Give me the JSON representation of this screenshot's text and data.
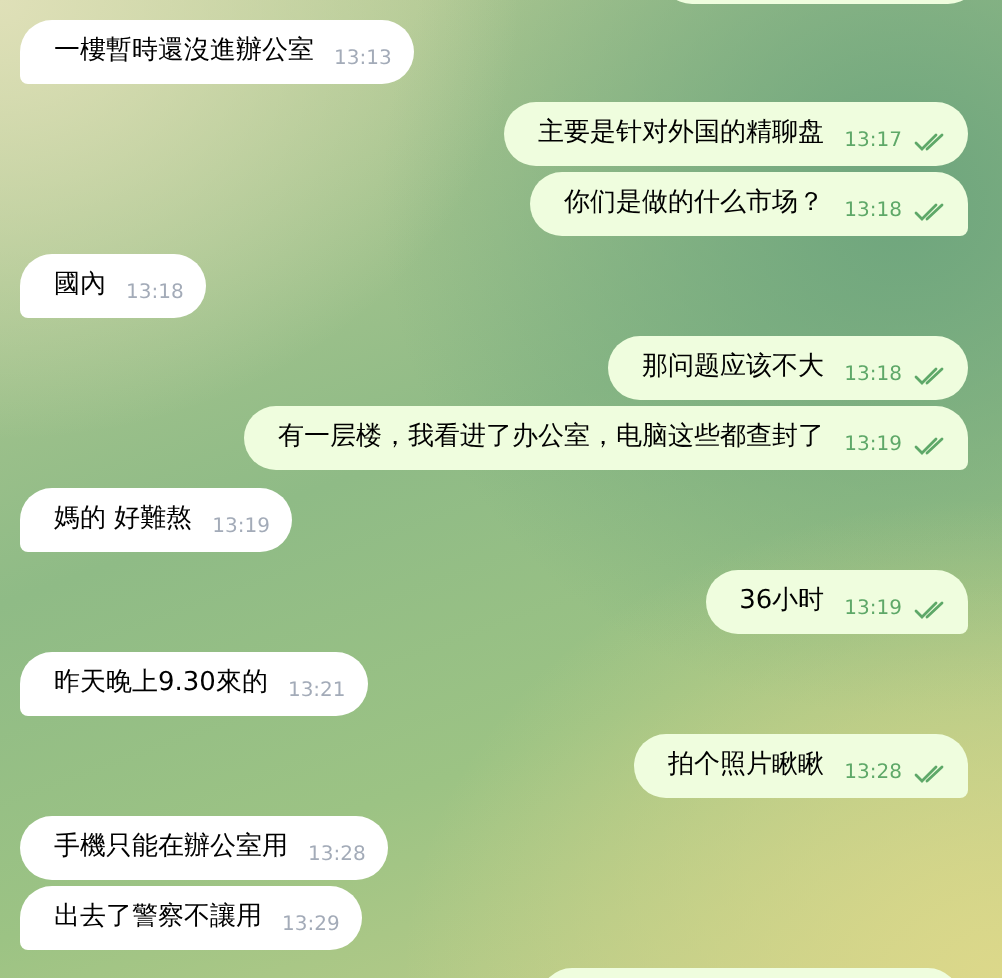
{
  "messages": [
    {
      "kind": "incoming",
      "text": "一樓暫時還沒進辦公室",
      "time": "13:13"
    },
    {
      "kind": "outgoing",
      "text": "主要是针对外国的精聊盘",
      "time": "13:17",
      "read": true
    },
    {
      "kind": "outgoing",
      "text": "你们是做的什么市场？",
      "time": "13:18",
      "read": true
    },
    {
      "kind": "incoming",
      "text": "國內",
      "time": "13:18"
    },
    {
      "kind": "outgoing",
      "text": "那问题应该不大",
      "time": "13:18",
      "read": true
    },
    {
      "kind": "outgoing",
      "text": "有一层楼，我看进了办公室，电脑这些都查封了",
      "time": "13:19",
      "read": true
    },
    {
      "kind": "incoming",
      "text": "媽的  好難熬",
      "time": "13:19"
    },
    {
      "kind": "outgoing",
      "text": "36小时",
      "time": "13:19",
      "read": true
    },
    {
      "kind": "incoming",
      "text": "昨天晚上9.30來的",
      "time": "13:21"
    },
    {
      "kind": "outgoing",
      "text": "拍个照片瞅瞅",
      "time": "13:28",
      "read": true
    },
    {
      "kind": "incoming",
      "text": "手機只能在辦公室用",
      "time": "13:28"
    },
    {
      "kind": "incoming",
      "text": "出去了警察不讓用",
      "time": "13:29"
    }
  ]
}
